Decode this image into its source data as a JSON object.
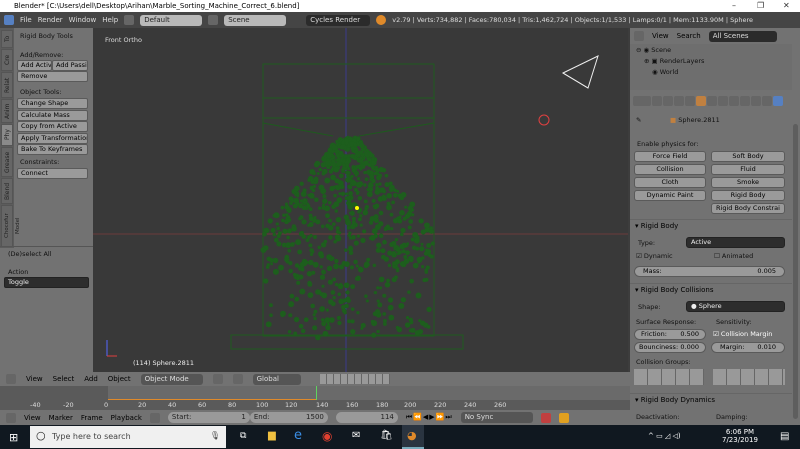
{
  "window": {
    "title": "Blender* [C:\\Users\\dell\\Desktop\\Arihan\\Marble_Sorting_Machine_Correct_6.blend]",
    "min": "–",
    "max": "❐",
    "close": "✕"
  },
  "topbar": {
    "menus": [
      "File",
      "Render",
      "Window",
      "Help"
    ],
    "layout": "Default",
    "scene": "Scene",
    "engine": "Cycles Render",
    "stats": "v2.79 | Verts:734,882 | Faces:780,034 | Tris:1,462,724 | Objects:1/1,533 | Lamps:0/1 | Mem:1133.90M | Sphere"
  },
  "shelf": {
    "tabs": [
      "To",
      "Cre",
      "Relat",
      "Anim",
      "Phy",
      "Grease",
      "Blend",
      "Chocofur Model"
    ],
    "panel_title": "Rigid Body Tools",
    "add_remove": "Add/Remove:",
    "add_active": "Add Activ",
    "add_passive": "Add Passiv",
    "remove": "Remove",
    "object_tools": "Object Tools:",
    "tools": [
      "Change Shape",
      "Calculate Mass",
      "Copy from Active",
      "Apply Transformation",
      "Bake To Keyframes"
    ],
    "constraints": "Constraints:",
    "connect": "Connect",
    "operator_title": "(De)select All",
    "action_label": "Action",
    "action_value": "Toggle"
  },
  "viewport": {
    "view_name": "Front Ortho",
    "object_info": "(114) Sphere.2811"
  },
  "outliner": {
    "view": "View",
    "search": "Search",
    "filter": "All Scenes",
    "items": [
      "Scene",
      "RenderLayers",
      "World"
    ]
  },
  "properties": {
    "object": "Sphere.2811",
    "enable_physics": "Enable physics for:",
    "physics": [
      "Force Field",
      "Soft Body",
      "Collision",
      "Fluid",
      "Cloth",
      "Smoke",
      "Dynamic Paint",
      "Rigid Body",
      "Rigid Body Constrai"
    ],
    "rigid_body": {
      "title": "Rigid Body",
      "type_label": "Type:",
      "type": "Active",
      "dynamic": "Dynamic",
      "animated": "Animated",
      "mass_label": "Mass:",
      "mass": "0.005"
    },
    "collisions": {
      "title": "Rigid Body Collisions",
      "shape_label": "Shape:",
      "shape": "Sphere",
      "surface": "Surface Response:",
      "sensitivity": "Sensitivity:",
      "friction_label": "Friction:",
      "friction": "0.500",
      "bounciness_label": "Bounciness:",
      "bounciness": "0.000",
      "collision_margin": "Collision Margin",
      "margin_label": "Margin:",
      "margin": "0.010",
      "groups": "Collision Groups:"
    },
    "dynamics": {
      "title": "Rigid Body Dynamics",
      "deactivation": "Deactivation:",
      "damping": "Damping:"
    }
  },
  "header3d": {
    "menus": [
      "View",
      "Select",
      "Add",
      "Object"
    ],
    "mode": "Object Mode",
    "orientation": "Global"
  },
  "timeline": {
    "ticks": [
      "-40",
      "-20",
      "0",
      "20",
      "40",
      "60",
      "80",
      "100",
      "120",
      "140",
      "160",
      "180",
      "200",
      "220",
      "240",
      "260"
    ],
    "current_frame": 114
  },
  "timeline_header": {
    "menus": [
      "View",
      "Marker",
      "Frame",
      "Playback"
    ],
    "start_label": "Start:",
    "start": "1",
    "end_label": "End:",
    "end": "1500",
    "frame": "114",
    "sync": "No Sync"
  },
  "taskbar": {
    "search_placeholder": "Type here to search",
    "time": "6:06 PM",
    "date": "7/23/2019"
  },
  "colors": {
    "accent": "#5680c2",
    "green": "#1e5a1e",
    "timeline_range": "#e08a2a",
    "frame_line": "#5fd35f"
  }
}
